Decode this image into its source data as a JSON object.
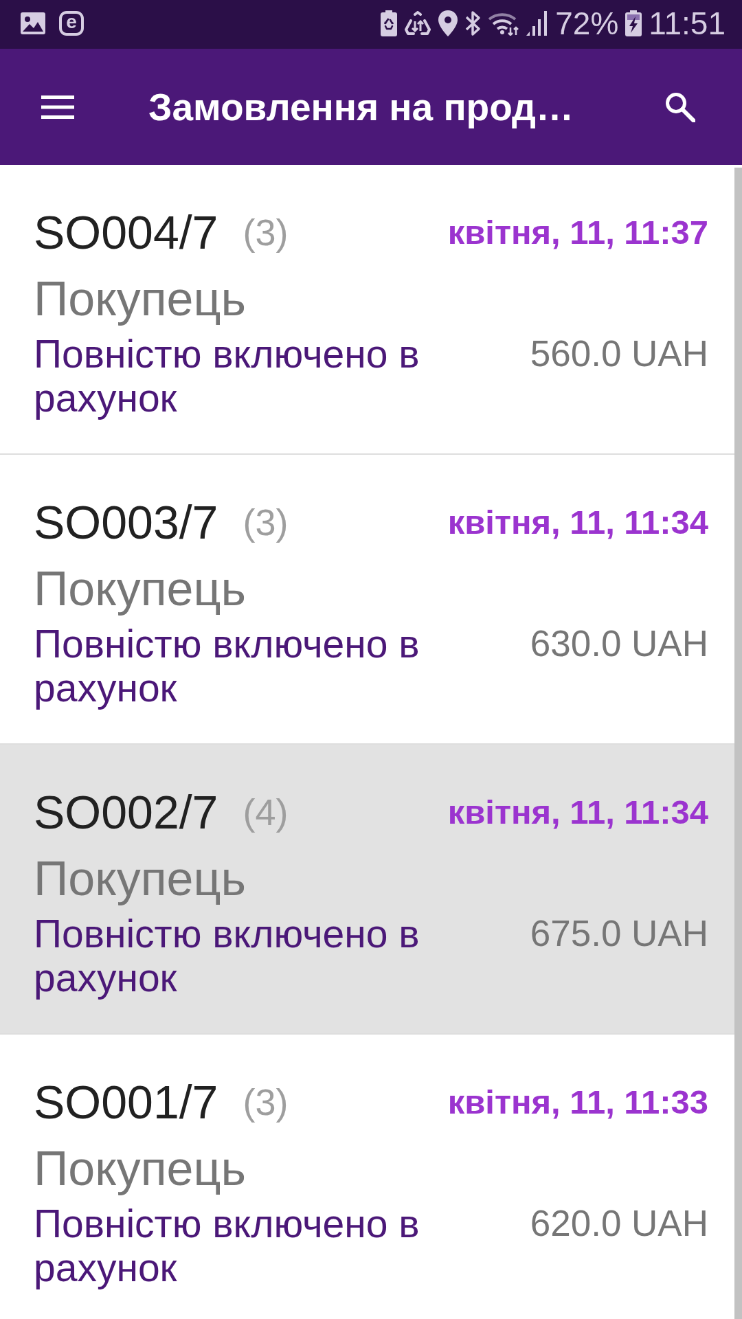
{
  "status_bar": {
    "notification_letter": "e",
    "battery_percent": "72%",
    "time": "11:51"
  },
  "app_bar": {
    "title": "Замовлення на прод…"
  },
  "orders": [
    {
      "number": "SO004/7",
      "line_count": "(3)",
      "date": "квітня, 11, 11:37",
      "customer": "Покупець",
      "invoice_status": "Повністю включено в рахунок",
      "amount": "560.0 UAH",
      "selected": false
    },
    {
      "number": "SO003/7",
      "line_count": "(3)",
      "date": "квітня, 11, 11:34",
      "customer": "Покупець",
      "invoice_status": "Повністю включено в рахунок",
      "amount": "630.0 UAH",
      "selected": false
    },
    {
      "number": "SO002/7",
      "line_count": "(4)",
      "date": "квітня, 11, 11:34",
      "customer": "Покупець",
      "invoice_status": "Повністю включено в рахунок",
      "amount": "675.0 UAH",
      "selected": true
    },
    {
      "number": "SO001/7",
      "line_count": "(3)",
      "date": "квітня, 11, 11:33",
      "customer": "Покупець",
      "invoice_status": "Повністю включено в рахунок",
      "amount": "620.0 UAH",
      "selected": false
    }
  ]
}
